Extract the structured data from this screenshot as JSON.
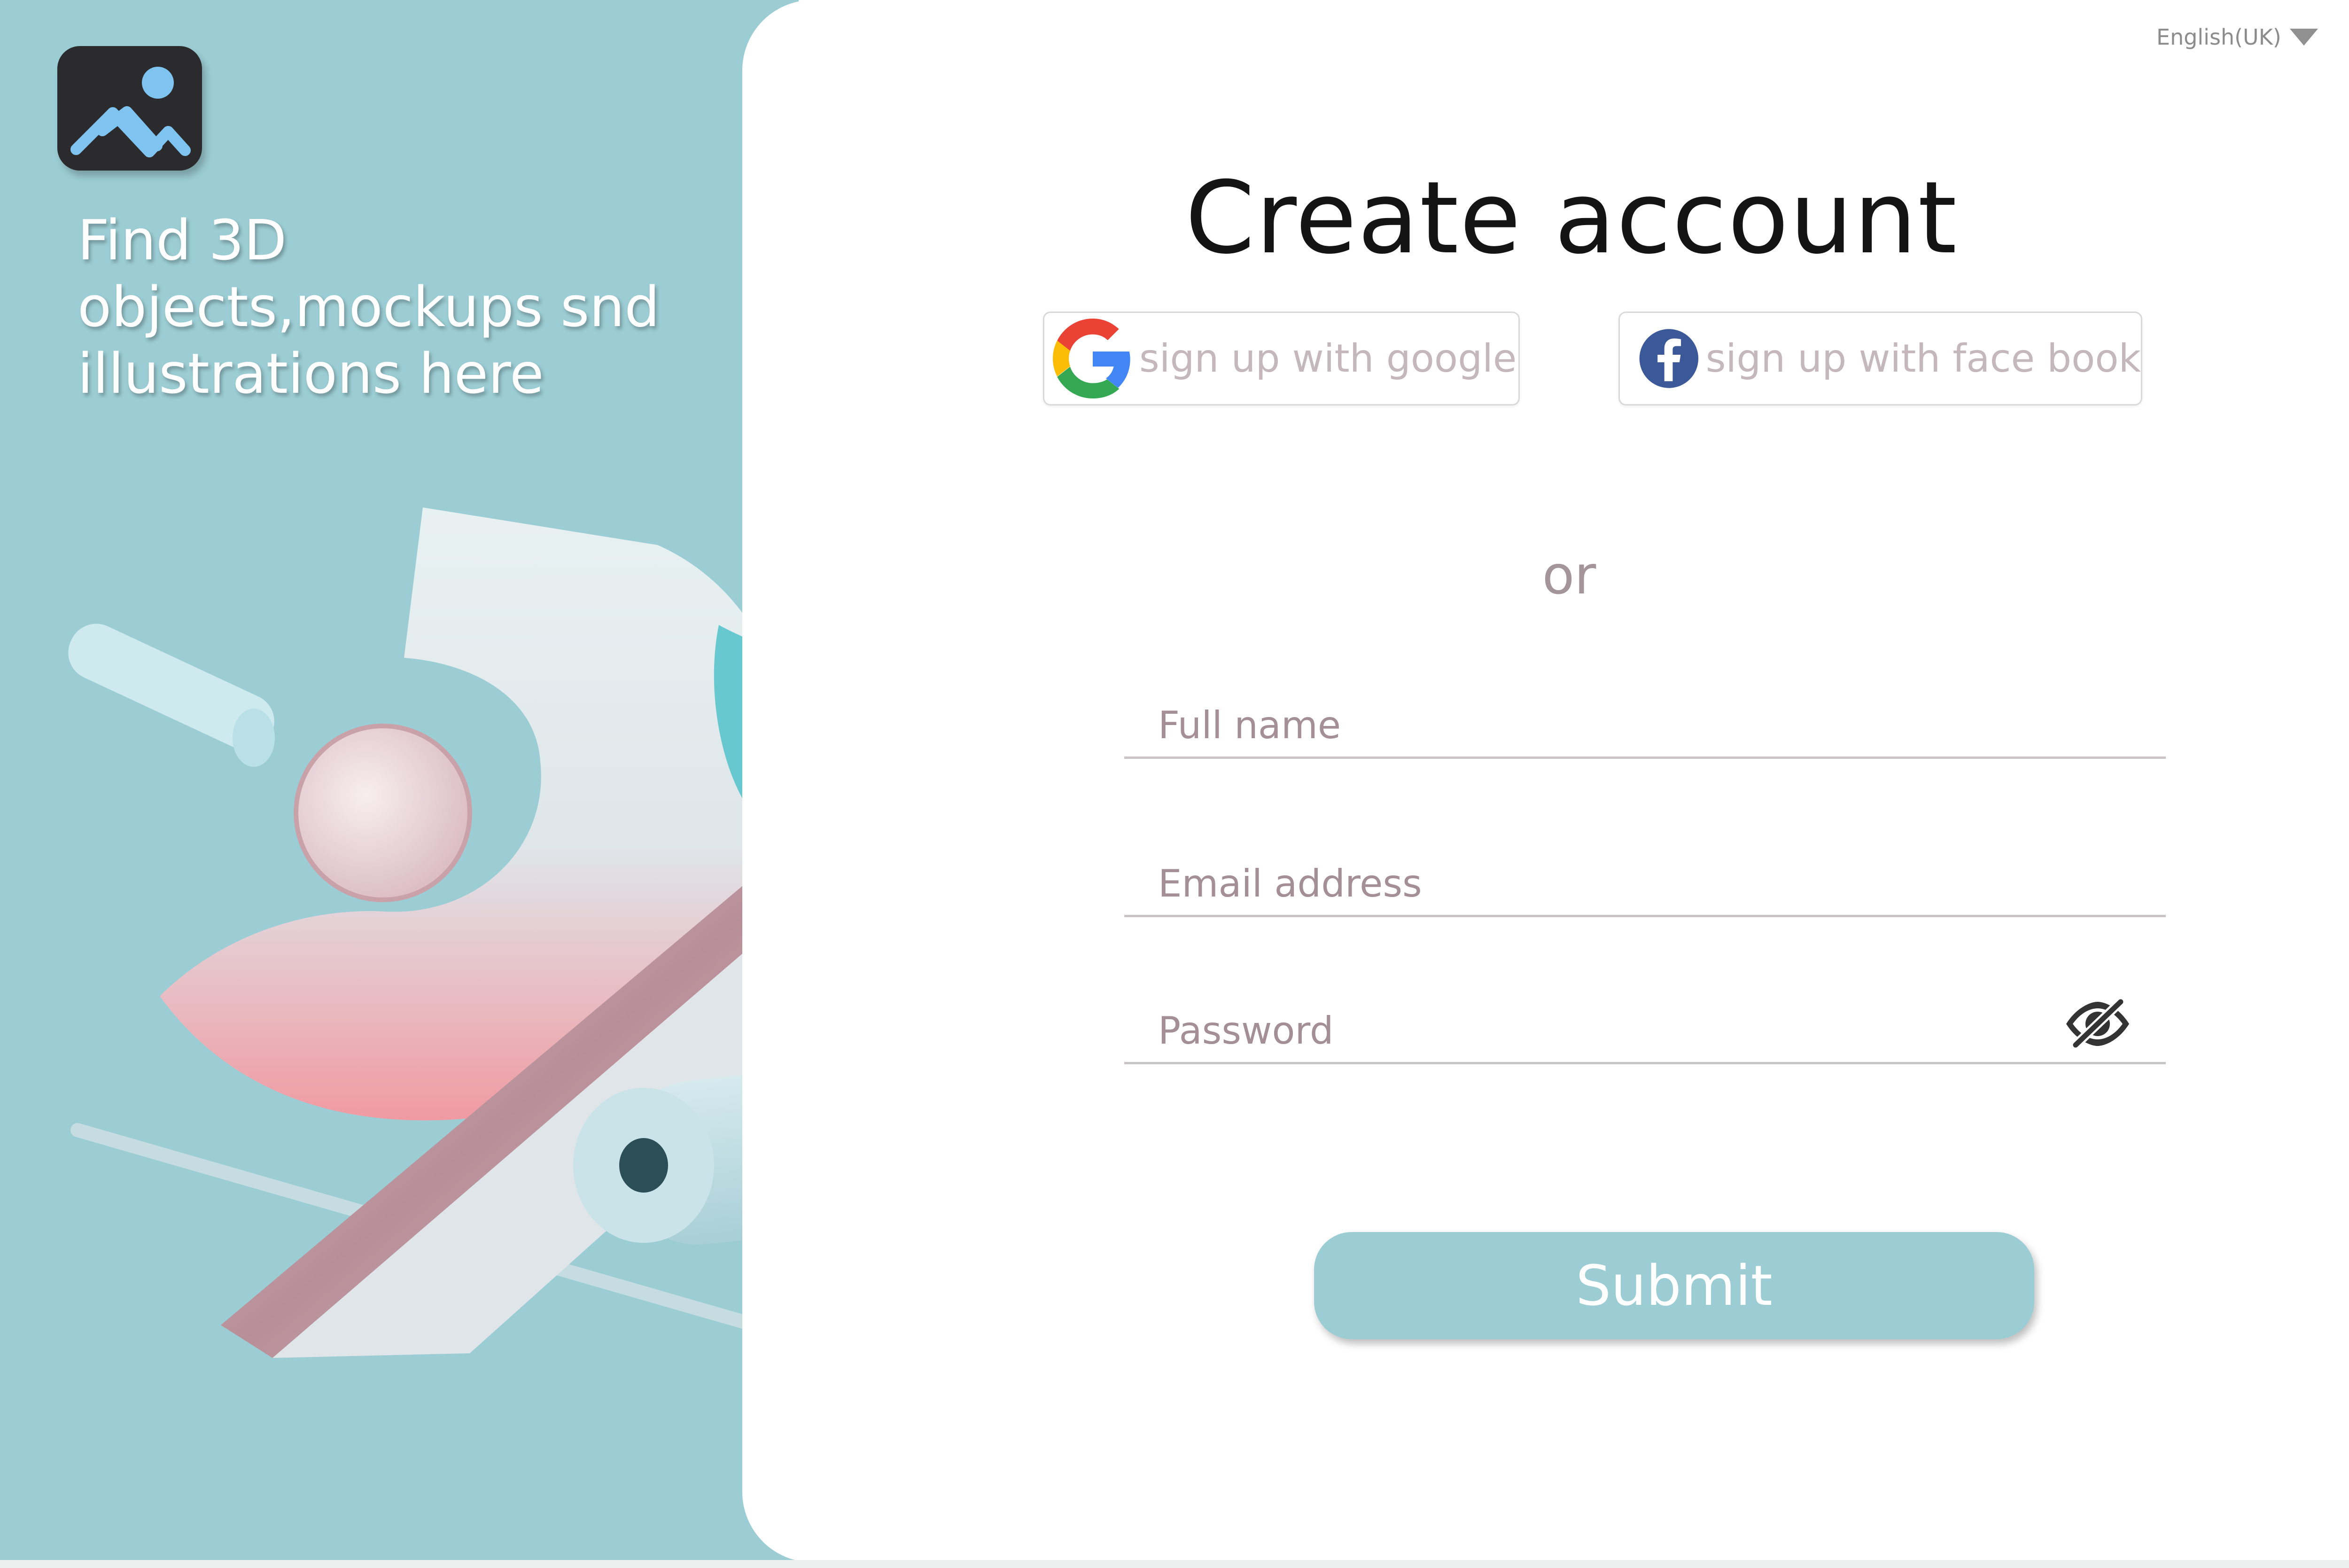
{
  "brand": {
    "logo_icon": "mountain-photo-icon",
    "tagline_lines": [
      "Find 3D",
      "objects,mockups snd",
      "illustrations here"
    ]
  },
  "language": {
    "label": "English(UK)",
    "icon": "caret-down-icon"
  },
  "form": {
    "title": "Create account",
    "google_label": "sign up with google",
    "facebook_label": "sign up with face book",
    "or_label": "or",
    "fullname_placeholder": "Full name",
    "email_placeholder": "Email address",
    "password_placeholder": "Password",
    "password_toggle_icon": "eye-slash-icon",
    "submit_label": "Submit"
  },
  "colors": {
    "accent": "#9ccdd4",
    "title": "#141414",
    "placeholder": "#a48f97",
    "social_text": "#c4b8bc"
  }
}
